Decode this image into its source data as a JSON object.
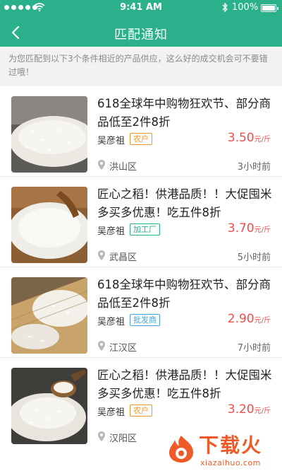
{
  "status_bar": {
    "time": "9:41 AM",
    "battery": "100%"
  },
  "nav": {
    "title": "匹配通知",
    "back_icon": "chevron-left-icon"
  },
  "notice": {
    "text": "为您匹配到以下3个条件相近的产品供应，这么好的成交机会可不要错过哦！"
  },
  "items": [
    {
      "title": "618全球年中购物狂欢节、部分商品低至2件8折",
      "seller": "吴彦祖",
      "tag": "农户",
      "price": "3.50",
      "unit": "元/斤",
      "district": "洪山区",
      "ago": "3小时前"
    },
    {
      "title": "匠心之稻！供港品质！！大促囤米多买多优惠！吃五件8折",
      "seller": "吴彦祖",
      "tag": "加工厂",
      "price": "3.70",
      "unit": "元/斤",
      "district": "武昌区",
      "ago": "5小时前"
    },
    {
      "title": "618全球年中购物狂欢节、部分商品低至2件8折",
      "seller": "吴彦祖",
      "tag": "批发商",
      "price": "2.90",
      "unit": "元/斤",
      "district": "江汉区",
      "ago": "7小时前"
    },
    {
      "title": "匠心之稻！供港品质！！大促囤米多买多优惠！吃五件8折",
      "seller": "吴彦祖",
      "tag": "农户",
      "price": "3.20",
      "unit": "元/斤",
      "district": "汉阳区",
      "ago": ""
    }
  ],
  "watermark": {
    "text": "下载火",
    "url": "xiazaihuo.com"
  },
  "colors": {
    "primary": "#2ab08a",
    "price": "#f24d4d",
    "tag_farmer": "#f0962b",
    "tag_factory": "#2ab08a",
    "tag_wholesaler": "#4aa3e0"
  }
}
